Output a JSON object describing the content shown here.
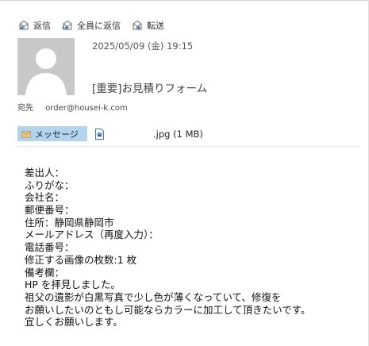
{
  "toolbar": {
    "reply": "返信",
    "reply_all": "全員に返信",
    "forward": "転送"
  },
  "header": {
    "datetime": "2025/05/09 (金) 19:15",
    "subject": "[重要]お見積りフォーム",
    "to_label": "宛先",
    "to_address": "order@housei-k.com"
  },
  "attachments": {
    "message_tab": "メッセージ",
    "file_name": ".jpg (1 MB)"
  },
  "body": {
    "lines": [
      "差出人：",
      "ふりがな：",
      "会社名：",
      "郵便番号：",
      "住所：静岡県静岡市",
      "メールアドレス（再度入力）：",
      "電話番号：",
      "修正する画像の枚数:1 枚",
      "備考欄：",
      "HP を拝見しました。",
      "祖父の遺影が白黒写真で少し色が薄くなっていて、修復を",
      "お願いしたいのともし可能ならカラーに加工して頂きたいです。",
      "宜しくお願いします。"
    ]
  },
  "colors": {
    "message_tab_bg": "#b3d4ee",
    "avatar_bg": "#c8c8c8"
  }
}
